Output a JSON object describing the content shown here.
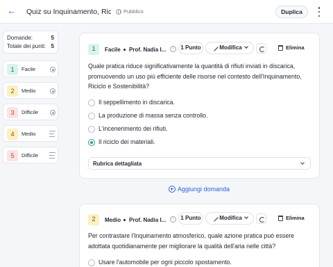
{
  "header": {
    "title": "Quiz su Inquinamento, Ricicl...",
    "visibility": "Pubblico",
    "duplicate_label": "Duplica"
  },
  "summary": {
    "domande_label": "Domande:",
    "domande_value": "5",
    "punti_label": "Totale dei punti:",
    "punti_value": "5"
  },
  "nav": [
    {
      "number": "1",
      "difficulty": "Facile",
      "icon": "radio-icon"
    },
    {
      "number": "2",
      "difficulty": "Medio",
      "icon": "radio-icon"
    },
    {
      "number": "3",
      "difficulty": "Difficile",
      "icon": "radio-icon"
    },
    {
      "number": "4",
      "difficulty": "Medio",
      "icon": "lines-icon"
    },
    {
      "number": "5",
      "difficulty": "Difficile",
      "icon": "lines-icon"
    }
  ],
  "questions": [
    {
      "number": "1",
      "difficulty": "Facile",
      "author": "Prof. Nadia I...",
      "points": "1 Punto",
      "edit_label": "Modifica",
      "delete_label": "Elimina",
      "text": "Quale pratica riduce significativamente la quantità di rifiuti inviati in discarica, promuovendo un uso più efficiente delle risorse nel contesto dell'Inquinamento, Riciclo e Sostenibilità?",
      "options": [
        "Il seppellimento in discarica.",
        "La produzione di massa senza controllo.",
        "L'incenerimento dei rifiuti.",
        "Il riciclo dei materiali."
      ],
      "selected_option": 3,
      "rubric_label": "Rubrica dettagliata"
    },
    {
      "number": "2",
      "difficulty": "Medio",
      "author": "Prof. Nadia I...",
      "points": "1 Punto",
      "edit_label": "Modifica",
      "delete_label": "Elimina",
      "text": "Per contrastare l'Inquinamento atmosferico, quale azione pratica può essere adottata quotidianamente per migliorare la qualità dell'aria nelle città?",
      "options": [
        "Usare l'automobile per ogni piccolo spostamento."
      ]
    }
  ],
  "add_question_label": "Aggiungi domanda",
  "colors": {
    "accent": "#2e63d6",
    "selected": "#2ea08c",
    "facile": "#d8f2ee",
    "medio": "#fcefc0",
    "difficile": "#fde2e2"
  }
}
